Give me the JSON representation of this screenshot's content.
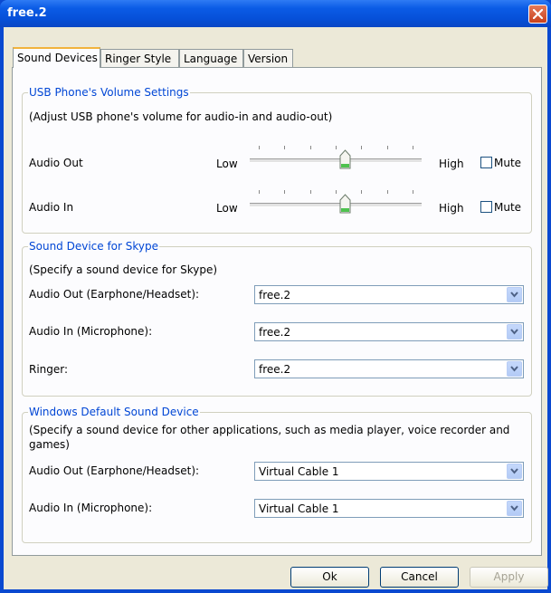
{
  "window": {
    "title": "free.2"
  },
  "tabs": [
    "Sound Devices",
    "Ringer Style",
    "Language",
    "Version"
  ],
  "volume": {
    "group_title": "USB Phone's Volume Settings",
    "description": "(Adjust USB phone's volume for audio-in and audio-out)",
    "rows": [
      {
        "label": "Audio Out",
        "low": "Low",
        "high": "High",
        "mute": "Mute",
        "level": 0.55,
        "muted": false
      },
      {
        "label": "Audio In",
        "low": "Low",
        "high": "High",
        "mute": "Mute",
        "level": 0.55,
        "muted": false
      }
    ]
  },
  "skype": {
    "group_title": "Sound Device for Skype",
    "description": "(Specify a sound device for Skype)",
    "rows": [
      {
        "label": "Audio Out (Earphone/Headset):",
        "value": "free.2"
      },
      {
        "label": "Audio In (Microphone):",
        "value": "free.2"
      },
      {
        "label": "Ringer:",
        "value": "free.2"
      }
    ]
  },
  "windows_default": {
    "group_title": "Windows Default Sound Device",
    "description_line1": "(Specify a sound device for other applications, such as media player, voice recorder and",
    "description_line2": "games)",
    "rows": [
      {
        "label": "Audio Out (Earphone/Headset):",
        "value": "Virtual Cable 1"
      },
      {
        "label": "Audio In (Microphone):",
        "value": "Virtual Cable 1"
      }
    ]
  },
  "buttons": {
    "ok": "Ok",
    "cancel": "Cancel",
    "apply": "Apply"
  },
  "colors": {
    "title_bar": "#0b5ce6",
    "group_title": "#0046d5",
    "dialog_bg": "#ece9d8",
    "close_button": "#d2532d"
  }
}
